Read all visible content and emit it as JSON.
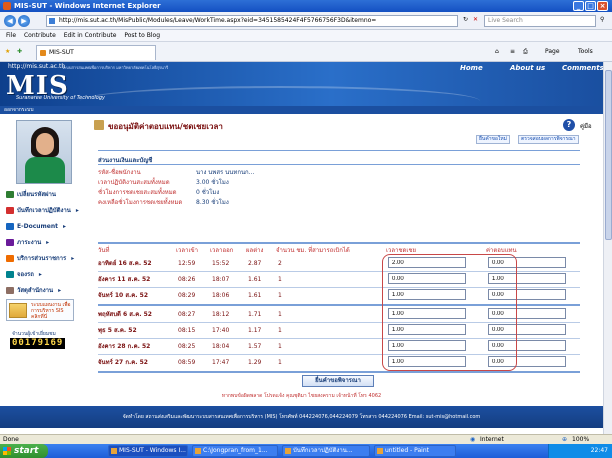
{
  "window": {
    "title": "MIS-SUT - Windows Internet Explorer"
  },
  "address": {
    "url": "http://mis.sut.ac.th/MisPublic/Modules/Leave/WorkTime.aspx?eid=3451585424F4F5766756F3D&itemno=",
    "search_placeholder": "Live Search"
  },
  "commandbar": {
    "file": "File",
    "contribute": "Contribute",
    "edit_contribute": "Edit in Contribute",
    "post_blog": "Post to Blog"
  },
  "tab": {
    "label": "MIS-SUT"
  },
  "toolbar": {
    "page": "Page",
    "tools": "Tools"
  },
  "banner": {
    "url_text": "http://mis.sut.ac.th",
    "sub_text": "ระบบสารสนเทศเพื่อการบริหาร มหาวิทยาลัยเทคโนโลยีสุรนารี",
    "logo": "MIS",
    "logo_sub": "Suranaree University of Technology",
    "links": [
      "Home",
      "About us",
      "Comments"
    ],
    "stripe": "ออกจากระบบ"
  },
  "sidebar": {
    "menu": [
      {
        "label": "เปลี่ยนรหัสผ่าน",
        "color": "#2e7d32"
      },
      {
        "label": "บันทึกเวลาปฏิบัติงาน",
        "color": "#d32f2f"
      },
      {
        "label": "E-Document",
        "color": "#1565c0"
      },
      {
        "label": "ภาระงาน",
        "color": "#6a1b9a"
      },
      {
        "label": "บริการส่วนราชการ",
        "color": "#ef6c00"
      },
      {
        "label": "จองรถ",
        "color": "#00838f"
      },
      {
        "label": "วัสดุสำนักงาน",
        "color": "#8d6e63"
      }
    ],
    "promo": "ระบบแผนงาน เพื่อการบริหาร SIS คลิกที่นี่",
    "counter_label": "จำนวนผู้เข้าเยี่ยมชม",
    "counter": "00179169"
  },
  "page": {
    "title": "ขออนุมัติค่าตอบแทน/ชดเชยเวลา",
    "help": "คู่มือ",
    "top_buttons": [
      "ยื่นคำขอใหม่",
      "ตรวจสอบผลการพิจารณา"
    ],
    "section_title": "ส่วนงานเงินและบัญชี",
    "info": [
      {
        "label": "รหัส-ชื่อพนักงาน",
        "value": "นาง นพสร นนทกนก…"
      },
      {
        "label": "เวลาปฏิบัติงานสะสมทั้งหมด",
        "value": "3.00 ชั่วโมง"
      },
      {
        "label": "ชั่วโมงการชดเชยสะสมทั้งหมด",
        "value": "0 ชั่วโมง"
      },
      {
        "label": "คงเหลือชั่วโมงการชดเชยทั้งหมด",
        "value": "8.30 ชั่วโมง"
      }
    ],
    "columns": [
      "วันที่",
      "เวลาเข้า",
      "เวลาออก",
      "ผลต่าง",
      "จำนวน ชม. ที่สามารถเบิกได้",
      "เวลาชดเชย",
      "ค่าตอบแทน"
    ],
    "rows": [
      {
        "date": "อาทิตย์ 16 ส.ค. 52",
        "in": "12:59",
        "out": "15:52",
        "diff": "2.87",
        "claimable": "2",
        "comp": "2.00",
        "pay": "0.00"
      },
      {
        "date": "อังคาร 11 ส.ค. 52",
        "in": "08:26",
        "out": "18:07",
        "diff": "1.61",
        "claimable": "1",
        "comp": "0.00",
        "pay": "1.00"
      },
      {
        "date": "จันทร์ 10 ส.ค. 52",
        "in": "08:29",
        "out": "18:06",
        "diff": "1.61",
        "claimable": "1",
        "comp": "1.00",
        "pay": "0.00"
      },
      {
        "date": "พฤหัสบดี 6 ส.ค. 52",
        "in": "08:27",
        "out": "18:12",
        "diff": "1.71",
        "claimable": "1",
        "comp": "1.00",
        "pay": "0.00"
      },
      {
        "date": "พุธ 5 ส.ค. 52",
        "in": "08:15",
        "out": "17:40",
        "diff": "1.17",
        "claimable": "1",
        "comp": "1.00",
        "pay": "0.00"
      },
      {
        "date": "อังคาร 28 ก.ค. 52",
        "in": "08:25",
        "out": "18:04",
        "diff": "1.57",
        "claimable": "1",
        "comp": "1.00",
        "pay": "0.00"
      },
      {
        "date": "จันทร์ 27 ก.ค. 52",
        "in": "08:59",
        "out": "17:47",
        "diff": "1.29",
        "claimable": "1",
        "comp": "1.00",
        "pay": "0.00"
      }
    ],
    "submit": "ยื่นคำขอพิจารณา",
    "note": "หากพบข้อผิดพลาด โปรดแจ้ง คุณชุติมา ไชยสงคราม เจ้าหน้าที่ โทร 4062",
    "footer": "จัดทำโดย สถานส่งเสริมและพัฒนาระบบสารสนเทศเพื่อการบริหาร (MIS) โทรศัพท์ 044224076,044224079 โทรสาร 044224076 Email: sut-mis@hotmail.com"
  },
  "status": {
    "left": "Done",
    "zone": "Internet",
    "zoom": "100%"
  },
  "taskbar": {
    "start": "start",
    "items": [
      "MIS-SUT - Windows I...",
      "C:\\Jongpran_from_1...",
      "บันทึกเวลาปฏิบัติงาน...",
      "untitled - Paint"
    ],
    "clock": "22:47"
  }
}
